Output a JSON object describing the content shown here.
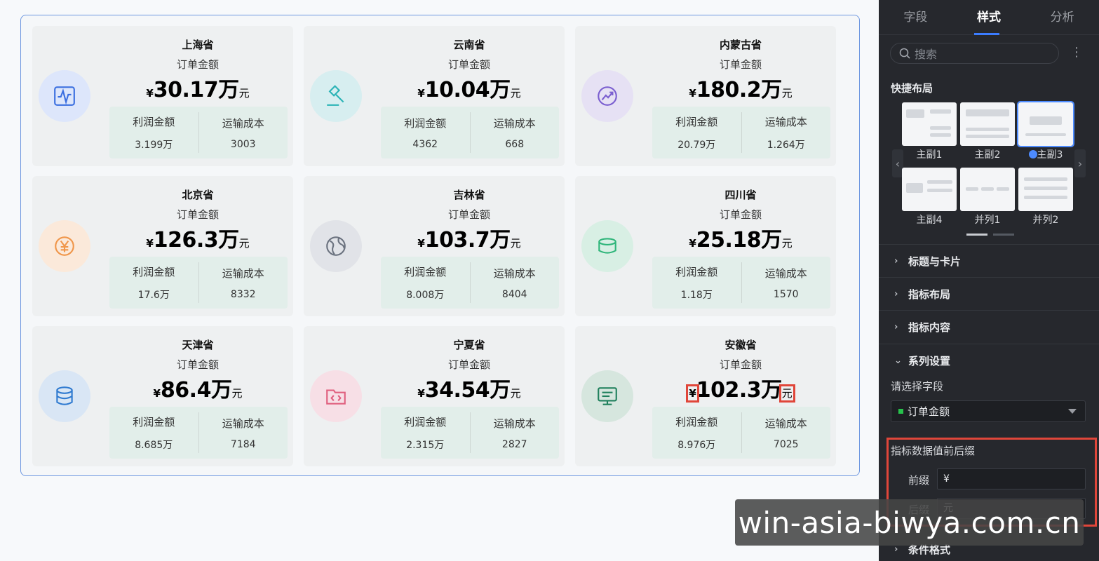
{
  "cards": [
    {
      "title": "上海省",
      "metric": "订单金额",
      "prefix": "¥",
      "value": "30.17万",
      "suffix": "元",
      "sub1_label": "利润金额",
      "sub1_value": "3.199万",
      "sub2_label": "运输成本",
      "sub2_value": "3003",
      "icon": "pulse-monitor-icon"
    },
    {
      "title": "云南省",
      "metric": "订单金额",
      "prefix": "¥",
      "value": "10.04万",
      "suffix": "元",
      "sub1_label": "利润金额",
      "sub1_value": "4362",
      "sub2_label": "运输成本",
      "sub2_value": "668",
      "icon": "gavel-icon"
    },
    {
      "title": "内蒙古省",
      "metric": "订单金额",
      "prefix": "¥",
      "value": "180.2万",
      "suffix": "元",
      "sub1_label": "利润金额",
      "sub1_value": "20.79万",
      "sub2_label": "运输成本",
      "sub2_value": "1.264万",
      "icon": "trend-up-icon"
    },
    {
      "title": "北京省",
      "metric": "订单金额",
      "prefix": "¥",
      "value": "126.3万",
      "suffix": "元",
      "sub1_label": "利润金额",
      "sub1_value": "17.6万",
      "sub2_label": "运输成本",
      "sub2_value": "8332",
      "icon": "yen-coin-icon"
    },
    {
      "title": "吉林省",
      "metric": "订单金额",
      "prefix": "¥",
      "value": "103.7万",
      "suffix": "元",
      "sub1_label": "利润金额",
      "sub1_value": "8.008万",
      "sub2_label": "运输成本",
      "sub2_value": "8404",
      "icon": "globe-icon"
    },
    {
      "title": "四川省",
      "metric": "订单金额",
      "prefix": "¥",
      "value": "25.18万",
      "suffix": "元",
      "sub1_label": "利润金额",
      "sub1_value": "1.18万",
      "sub2_label": "运输成本",
      "sub2_value": "1570",
      "icon": "cylinder-icon"
    },
    {
      "title": "天津省",
      "metric": "订单金额",
      "prefix": "¥",
      "value": "86.4万",
      "suffix": "元",
      "sub1_label": "利润金额",
      "sub1_value": "8.685万",
      "sub2_label": "运输成本",
      "sub2_value": "7184",
      "icon": "database-icon"
    },
    {
      "title": "宁夏省",
      "metric": "订单金额",
      "prefix": "¥",
      "value": "34.54万",
      "suffix": "元",
      "sub1_label": "利润金额",
      "sub1_value": "2.315万",
      "sub2_label": "运输成本",
      "sub2_value": "2827",
      "icon": "code-folder-icon"
    },
    {
      "title": "安徽省",
      "metric": "订单金额",
      "prefix": "¥",
      "value": "102.3万",
      "suffix": "元",
      "sub1_label": "利润金额",
      "sub1_value": "8.976万",
      "sub2_label": "运输成本",
      "sub2_value": "7025",
      "icon": "monitor-icon"
    }
  ],
  "panel": {
    "tabs": [
      "字段",
      "样式",
      "分析"
    ],
    "active_tab": "样式",
    "search_placeholder": "搜索",
    "quick_layout_title": "快捷布局",
    "layouts": [
      "主副1",
      "主副2",
      "主副3",
      "主副4",
      "并列1",
      "并列2"
    ],
    "selected_layout": "主副3",
    "sections": [
      "标题与卡片",
      "指标布局",
      "指标内容"
    ],
    "series_section": "系列设置",
    "choose_field_label": "请选择字段",
    "selected_field": "订单金额",
    "affix_title": "指标数据值前后缀",
    "prefix_label": "前缀",
    "prefix_value": "¥",
    "suffix_label": "后缀",
    "suffix_value": "元",
    "last_section": "条件格式"
  },
  "watermark": "win-asia-biwya.com.cn",
  "colors": {
    "accent": "#3b7cff",
    "highlight": "#e0463a",
    "panel_bg": "#26282d"
  }
}
